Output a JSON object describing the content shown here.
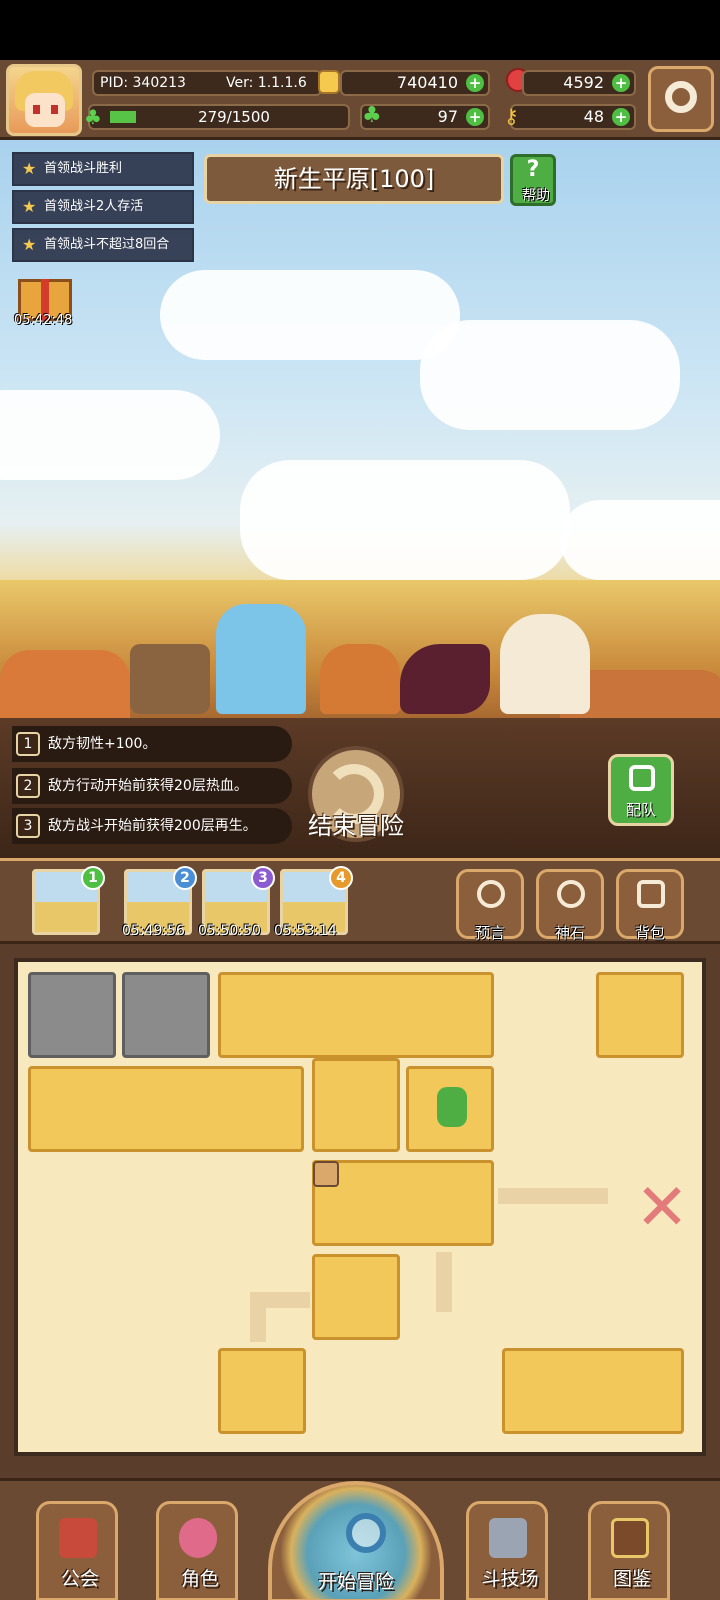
{
  "header": {
    "pid": "PID: 340213",
    "version": "Ver: 1.1.1.6",
    "energy": "279/1500",
    "gold": "740410",
    "gems": "4592",
    "clover": "97",
    "keys": "48"
  },
  "quests": [
    "首领战斗胜利",
    "首领战斗2人存活",
    "首领战斗不超过8回合"
  ],
  "gift_timer": "05:42:48",
  "region": {
    "title": "新生平原[100]",
    "help_label": "帮助"
  },
  "effects": [
    {
      "num": "1",
      "text": "敌方韧性+100。"
    },
    {
      "num": "2",
      "text": "敌方行动开始前获得20层热血。"
    },
    {
      "num": "3",
      "text": "敌方战斗开始前获得200层再生。"
    }
  ],
  "controls": {
    "end_label": "结束冒险",
    "team_label": "配队"
  },
  "stages": [
    {
      "badge": "1",
      "timer": "",
      "color": "#4fbf44"
    },
    {
      "badge": "2",
      "timer": "05:49:56",
      "color": "#4a8fd6"
    },
    {
      "badge": "3",
      "timer": "05:50:50",
      "color": "#8c5bd0"
    },
    {
      "badge": "4",
      "timer": "05:53:14",
      "color": "#e69a2e"
    }
  ],
  "tools": {
    "prophecy": "预言",
    "godstone": "神石",
    "backpack": "背包"
  },
  "nav": {
    "guild": "公会",
    "character": "角色",
    "start": "开始冒险",
    "arena": "斗技场",
    "codex": "图鉴"
  }
}
